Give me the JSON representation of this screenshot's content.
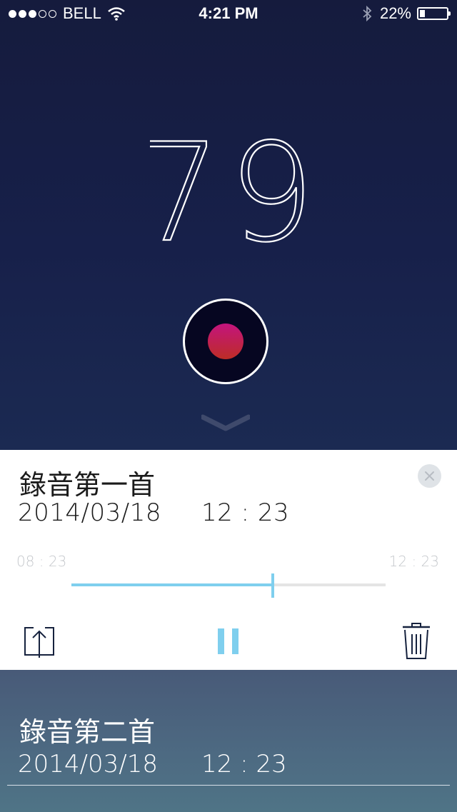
{
  "status_bar": {
    "signal_dots_filled": 3,
    "signal_dots_total": 5,
    "carrier": "BELL",
    "time": "4:21 PM",
    "battery": "22%",
    "battery_level": 0.22
  },
  "recorder": {
    "counter": "79",
    "record_color_top": "#c4147e",
    "record_color_bottom": "#bd2d26",
    "collapse_icon": "chevron-down-icon"
  },
  "current_recording": {
    "title": "錄音第一首",
    "date": "2014/03/18",
    "time": "12 : 23",
    "elapsed": "08 : 23",
    "total": "12 : 23",
    "progress": 0.64,
    "accent": "#7fcfee",
    "close_icon": "close-icon",
    "share_icon": "share-icon",
    "pause_icon": "pause-icon",
    "trash_icon": "trash-icon"
  },
  "recordings": [
    {
      "title": "錄音第二首",
      "date": "2014/03/18",
      "time": "12 : 23"
    }
  ]
}
